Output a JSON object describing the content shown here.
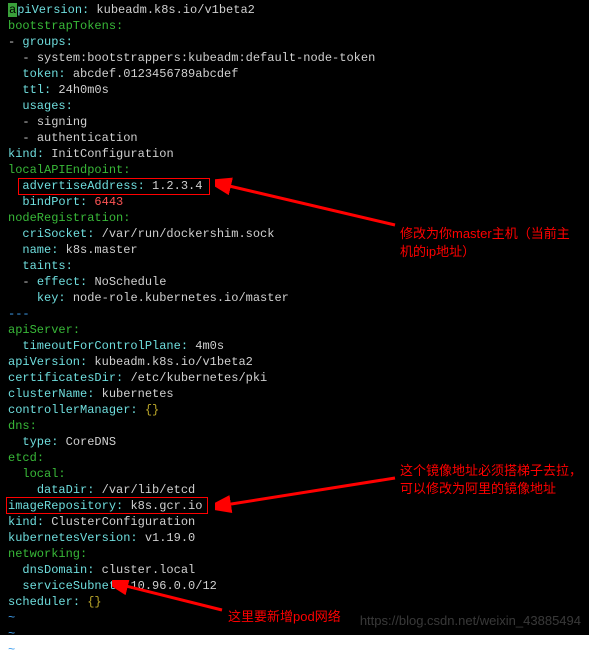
{
  "code": {
    "l0": {
      "k": "a",
      "rest": "piVersion",
      "v": "kubeadm.k8s.io/v1beta2"
    },
    "l1": {
      "k": "bootstrapTokens"
    },
    "l2": {
      "k": "groups"
    },
    "l3": {
      "v": "system:bootstrappers:kubeadm:default-node-token"
    },
    "l4": {
      "k": "token",
      "v": "abcdef.0123456789abcdef"
    },
    "l5": {
      "k": "ttl",
      "v": "24h0m0s"
    },
    "l6": {
      "k": "usages"
    },
    "l7": {
      "v": "signing"
    },
    "l8": {
      "v": "authentication"
    },
    "l9": {
      "k": "kind",
      "v": "InitConfiguration"
    },
    "l10": {
      "k": "localAPIEndpoint"
    },
    "l11": {
      "k": "advertiseAddress",
      "v": "1.2.3.4"
    },
    "l12": {
      "k": "bindPort",
      "v": "6443"
    },
    "l13": {
      "k": "nodeRegistration"
    },
    "l14": {
      "k": "criSocket",
      "v": "/var/run/dockershim.sock"
    },
    "l15": {
      "k": "name",
      "v": "k8s.master"
    },
    "l16": {
      "k": "taints"
    },
    "l17": {
      "k": "effect",
      "v": "NoSchedule"
    },
    "l18": {
      "k": "key",
      "v": "node-role.kubernetes.io/master"
    },
    "l19": {
      "v": "---"
    },
    "l20": {
      "k": "apiServer"
    },
    "l21": {
      "k": "timeoutForControlPlane",
      "v": "4m0s"
    },
    "l22": {
      "k": "apiVersion",
      "v": "kubeadm.k8s.io/v1beta2"
    },
    "l23": {
      "k": "certificatesDir",
      "v": "/etc/kubernetes/pki"
    },
    "l24": {
      "k": "clusterName",
      "v": "kubernetes"
    },
    "l25": {
      "k": "controllerManager",
      "v": "{}"
    },
    "l26": {
      "k": "dns"
    },
    "l27": {
      "k": "type",
      "v": "CoreDNS"
    },
    "l28": {
      "k": "etcd"
    },
    "l29": {
      "k": "local"
    },
    "l30": {
      "k": "dataDir",
      "v": "/var/lib/etcd"
    },
    "l31": {
      "k": "imageRepository",
      "v": "k8s.gcr.io"
    },
    "l32": {
      "k": "kind",
      "v": "ClusterConfiguration"
    },
    "l33": {
      "k": "kubernetesVersion",
      "v": "v1.19.0"
    },
    "l34": {
      "k": "networking"
    },
    "l35": {
      "k": "dnsDomain",
      "v": "cluster.local"
    },
    "l36": {
      "k": "serviceSubnet",
      "v": "10.96.0.0/12"
    },
    "l37": {
      "k": "scheduler",
      "v": "{}"
    }
  },
  "annotations": {
    "a1": "修改为你master主机（当前主机的ip地址）",
    "a2": "这个镜像地址必须搭梯子去拉，可以修改为阿里的镜像地址",
    "a3": "这里要新增pod网络"
  },
  "watermark": "https://blog.csdn.net/weixin_43885494",
  "tilde": "~"
}
